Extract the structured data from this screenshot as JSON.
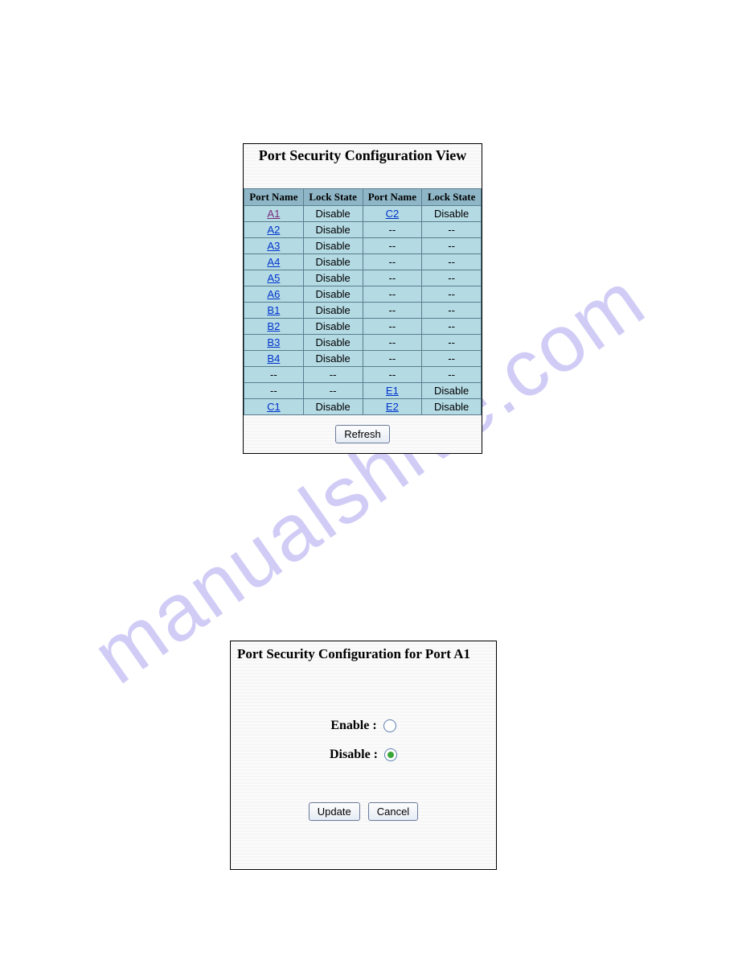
{
  "watermark": "manualshive.com",
  "panel1": {
    "title": "Port Security Configuration View",
    "headers": [
      "Port Name",
      "Lock State",
      "Port Name",
      "Lock State"
    ],
    "rows": [
      {
        "p1": "A1",
        "p1l": true,
        "p1v": true,
        "s1": "Disable",
        "p2": "C2",
        "p2l": true,
        "s2": "Disable"
      },
      {
        "p1": "A2",
        "p1l": true,
        "s1": "Disable",
        "p2": "--",
        "p2l": false,
        "s2": "--"
      },
      {
        "p1": "A3",
        "p1l": true,
        "s1": "Disable",
        "p2": "--",
        "p2l": false,
        "s2": "--"
      },
      {
        "p1": "A4",
        "p1l": true,
        "s1": "Disable",
        "p2": "--",
        "p2l": false,
        "s2": "--"
      },
      {
        "p1": "A5",
        "p1l": true,
        "s1": "Disable",
        "p2": "--",
        "p2l": false,
        "s2": "--"
      },
      {
        "p1": "A6",
        "p1l": true,
        "s1": "Disable",
        "p2": "--",
        "p2l": false,
        "s2": "--"
      },
      {
        "p1": "B1",
        "p1l": true,
        "s1": "Disable",
        "p2": "--",
        "p2l": false,
        "s2": "--"
      },
      {
        "p1": "B2",
        "p1l": true,
        "s1": "Disable",
        "p2": "--",
        "p2l": false,
        "s2": "--"
      },
      {
        "p1": "B3",
        "p1l": true,
        "s1": "Disable",
        "p2": "--",
        "p2l": false,
        "s2": "--"
      },
      {
        "p1": "B4",
        "p1l": true,
        "s1": "Disable",
        "p2": "--",
        "p2l": false,
        "s2": "--"
      },
      {
        "p1": "--",
        "p1l": false,
        "s1": "--",
        "p2": "--",
        "p2l": false,
        "s2": "--"
      },
      {
        "p1": "--",
        "p1l": false,
        "s1": "--",
        "p2": "E1",
        "p2l": true,
        "s2": "Disable"
      },
      {
        "p1": "C1",
        "p1l": true,
        "s1": "Disable",
        "p2": "E2",
        "p2l": true,
        "s2": "Disable"
      }
    ],
    "refresh_label": "Refresh"
  },
  "panel2": {
    "title": "Port Security Configuration for Port A1",
    "enable_label": "Enable  :",
    "disable_label": "Disable :",
    "selected": "disable",
    "update_label": "Update",
    "cancel_label": "Cancel"
  }
}
